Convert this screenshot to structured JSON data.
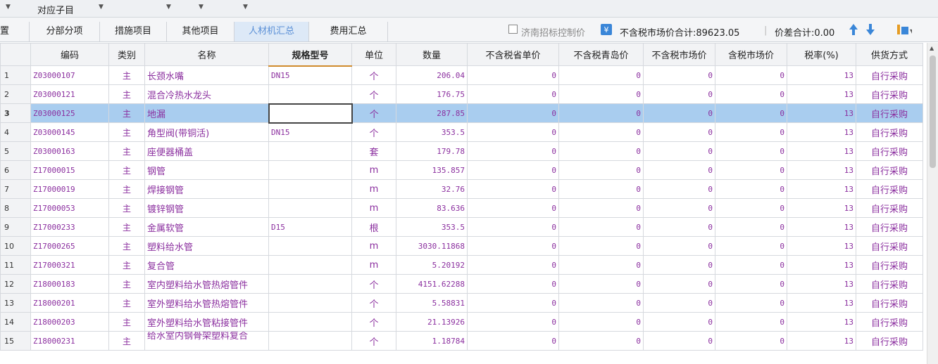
{
  "filter_bar": {
    "label": "对应子目"
  },
  "tabs": [
    {
      "label": "置"
    },
    {
      "label": "分部分项"
    },
    {
      "label": "措施项目"
    },
    {
      "label": "其他项目"
    },
    {
      "label": "人材机汇总"
    },
    {
      "label": "费用汇总"
    }
  ],
  "toolbar": {
    "checkbox_label": "济南招标控制价",
    "total_label": "不含税市场价合计:89623.05",
    "diff_label": "价差合计:0.00"
  },
  "columns": [
    "",
    "编码",
    "类别",
    "名称",
    "规格型号",
    "单位",
    "数量",
    "不含税省单价",
    "不含税青岛价",
    "不含税市场价",
    "含税市场价",
    "税率(%)",
    "供货方式"
  ],
  "rows": [
    {
      "n": "1",
      "code": "Z03000107",
      "cat": "主",
      "name": "长颈水嘴",
      "spec": "DN15",
      "unit": "个",
      "qty": "206.04",
      "p1": "0",
      "p2": "0",
      "p3": "0",
      "p4": "0",
      "tax": "13",
      "supply": "自行采购"
    },
    {
      "n": "2",
      "code": "Z03000121",
      "cat": "主",
      "name": "混合冷热水龙头",
      "spec": "",
      "unit": "个",
      "qty": "176.75",
      "p1": "0",
      "p2": "0",
      "p3": "0",
      "p4": "0",
      "tax": "13",
      "supply": "自行采购"
    },
    {
      "n": "3",
      "code": "Z03000125",
      "cat": "主",
      "name": "地漏",
      "spec": "",
      "unit": "个",
      "qty": "287.85",
      "p1": "0",
      "p2": "0",
      "p3": "0",
      "p4": "0",
      "tax": "13",
      "supply": "自行采购"
    },
    {
      "n": "4",
      "code": "Z03000145",
      "cat": "主",
      "name": "角型阀(带铜活)",
      "spec": "DN15",
      "unit": "个",
      "qty": "353.5",
      "p1": "0",
      "p2": "0",
      "p3": "0",
      "p4": "0",
      "tax": "13",
      "supply": "自行采购"
    },
    {
      "n": "5",
      "code": "Z03000163",
      "cat": "主",
      "name": "座便器桶盖",
      "spec": "",
      "unit": "套",
      "qty": "179.78",
      "p1": "0",
      "p2": "0",
      "p3": "0",
      "p4": "0",
      "tax": "13",
      "supply": "自行采购"
    },
    {
      "n": "6",
      "code": "Z17000015",
      "cat": "主",
      "name": "钢管",
      "spec": "",
      "unit": "m",
      "qty": "135.857",
      "p1": "0",
      "p2": "0",
      "p3": "0",
      "p4": "0",
      "tax": "13",
      "supply": "自行采购"
    },
    {
      "n": "7",
      "code": "Z17000019",
      "cat": "主",
      "name": "焊接钢管",
      "spec": "",
      "unit": "m",
      "qty": "32.76",
      "p1": "0",
      "p2": "0",
      "p3": "0",
      "p4": "0",
      "tax": "13",
      "supply": "自行采购"
    },
    {
      "n": "8",
      "code": "Z17000053",
      "cat": "主",
      "name": "镀锌钢管",
      "spec": "",
      "unit": "m",
      "qty": "83.636",
      "p1": "0",
      "p2": "0",
      "p3": "0",
      "p4": "0",
      "tax": "13",
      "supply": "自行采购"
    },
    {
      "n": "9",
      "code": "Z17000233",
      "cat": "主",
      "name": "金属软管",
      "spec": "D15",
      "unit": "根",
      "qty": "353.5",
      "p1": "0",
      "p2": "0",
      "p3": "0",
      "p4": "0",
      "tax": "13",
      "supply": "自行采购"
    },
    {
      "n": "10",
      "code": "Z17000265",
      "cat": "主",
      "name": "塑料给水管",
      "spec": "",
      "unit": "m",
      "qty": "3030.11868",
      "p1": "0",
      "p2": "0",
      "p3": "0",
      "p4": "0",
      "tax": "13",
      "supply": "自行采购"
    },
    {
      "n": "11",
      "code": "Z17000321",
      "cat": "主",
      "name": "复合管",
      "spec": "",
      "unit": "m",
      "qty": "5.20192",
      "p1": "0",
      "p2": "0",
      "p3": "0",
      "p4": "0",
      "tax": "13",
      "supply": "自行采购"
    },
    {
      "n": "12",
      "code": "Z18000183",
      "cat": "主",
      "name": "室内塑料给水管热熔管件",
      "spec": "",
      "unit": "个",
      "qty": "4151.62288",
      "p1": "0",
      "p2": "0",
      "p3": "0",
      "p4": "0",
      "tax": "13",
      "supply": "自行采购"
    },
    {
      "n": "13",
      "code": "Z18000201",
      "cat": "主",
      "name": "室外塑料给水管热熔管件",
      "spec": "",
      "unit": "个",
      "qty": "5.58831",
      "p1": "0",
      "p2": "0",
      "p3": "0",
      "p4": "0",
      "tax": "13",
      "supply": "自行采购"
    },
    {
      "n": "14",
      "code": "Z18000203",
      "cat": "主",
      "name": "室外塑料给水管粘接管件",
      "spec": "",
      "unit": "个",
      "qty": "21.13926",
      "p1": "0",
      "p2": "0",
      "p3": "0",
      "p4": "0",
      "tax": "13",
      "supply": "自行采购"
    },
    {
      "n": "15",
      "code": "Z18000231",
      "cat": "主",
      "name": "给水室内钢骨架塑料复合",
      "spec": "",
      "unit": "个",
      "qty": "1.18784",
      "p1": "0",
      "p2": "0",
      "p3": "0",
      "p4": "0",
      "tax": "13",
      "supply": "自行采购"
    }
  ],
  "selected_row": 3,
  "colors": {
    "accent": "#5a8fd6",
    "selection": "#a9cdef",
    "item_text": "#8b2f9f",
    "arrow_up": "#3a86d8",
    "arrow_down": "#3a86d8"
  }
}
